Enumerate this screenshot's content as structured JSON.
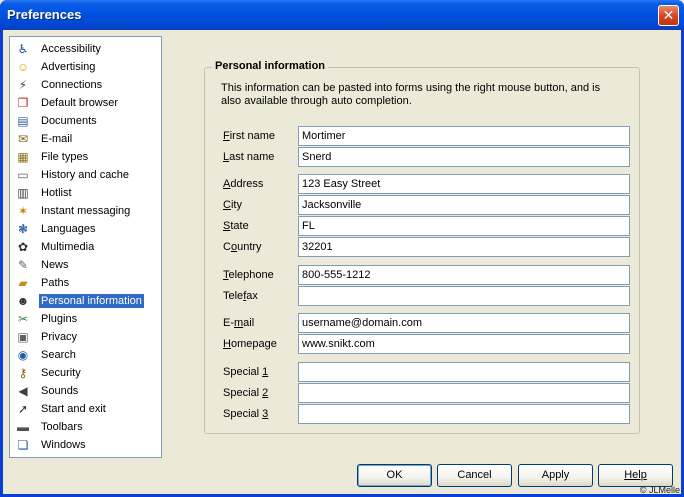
{
  "window": {
    "title": "Preferences",
    "close_glyph": "✕"
  },
  "categories": [
    {
      "label": "Accessibility",
      "icon": "accessibility-icon",
      "glyph": "♿",
      "color": "#1b3fa0"
    },
    {
      "label": "Advertising",
      "icon": "smiley-icon",
      "glyph": "☺",
      "color": "#d9a800"
    },
    {
      "label": "Connections",
      "icon": "connections-icon",
      "glyph": "⚡",
      "color": "#444444"
    },
    {
      "label": "Default browser",
      "icon": "browser-doc-icon",
      "glyph": "❐",
      "color": "#c02020"
    },
    {
      "label": "Documents",
      "icon": "documents-icon",
      "glyph": "▤",
      "color": "#3060a0"
    },
    {
      "label": "E-mail",
      "icon": "email-icon",
      "glyph": "✉",
      "color": "#806020"
    },
    {
      "label": "File types",
      "icon": "file-types-icon",
      "glyph": "▦",
      "color": "#907020"
    },
    {
      "label": "History and cache",
      "icon": "history-cache-icon",
      "glyph": "▭",
      "color": "#606060"
    },
    {
      "label": "Hotlist",
      "icon": "hotlist-icon",
      "glyph": "▥",
      "color": "#404040"
    },
    {
      "label": "Instant messaging",
      "icon": "instant-messaging-icon",
      "glyph": "✶",
      "color": "#c08000"
    },
    {
      "label": "Languages",
      "icon": "languages-icon",
      "glyph": "❃",
      "color": "#2050a0"
    },
    {
      "label": "Multimedia",
      "icon": "multimedia-icon",
      "glyph": "✿",
      "color": "#303030"
    },
    {
      "label": "News",
      "icon": "news-icon",
      "glyph": "✎",
      "color": "#606060"
    },
    {
      "label": "Paths",
      "icon": "paths-folder-icon",
      "glyph": "▰",
      "color": "#c09020"
    },
    {
      "label": "Personal information",
      "icon": "person-icon",
      "glyph": "☻",
      "color": "#303030"
    },
    {
      "label": "Plugins",
      "icon": "plugins-icon",
      "glyph": "✂",
      "color": "#408040"
    },
    {
      "label": "Privacy",
      "icon": "privacy-icon",
      "glyph": "▣",
      "color": "#606060"
    },
    {
      "label": "Search",
      "icon": "search-globe-icon",
      "glyph": "◉",
      "color": "#2060a0"
    },
    {
      "label": "Security",
      "icon": "security-keys-icon",
      "glyph": "⚷",
      "color": "#806000"
    },
    {
      "label": "Sounds",
      "icon": "sounds-speaker-icon",
      "glyph": "◀",
      "color": "#404040"
    },
    {
      "label": "Start and exit",
      "icon": "start-exit-icon",
      "glyph": "➚",
      "color": "#303030"
    },
    {
      "label": "Toolbars",
      "icon": "toolbars-icon",
      "glyph": "▬",
      "color": "#505050"
    },
    {
      "label": "Windows",
      "icon": "windows-icon",
      "glyph": "❏",
      "color": "#2050a0"
    }
  ],
  "selected_category": "Personal information",
  "panel": {
    "legend": "Personal information",
    "intro": "This information can be pasted into forms using the right mouse button, and is also available through auto completion.",
    "fields": [
      {
        "key": "first_name",
        "pre": "",
        "u": "F",
        "post": "irst name",
        "value": "Mortimer"
      },
      {
        "key": "last_name",
        "pre": "",
        "u": "L",
        "post": "ast name",
        "value": "Snerd"
      },
      {
        "key": "address",
        "pre": "",
        "u": "A",
        "post": "ddress",
        "value": "123 Easy Street"
      },
      {
        "key": "city",
        "pre": "",
        "u": "C",
        "post": "ity",
        "value": "Jacksonville"
      },
      {
        "key": "state",
        "pre": "",
        "u": "S",
        "post": "tate",
        "value": "FL"
      },
      {
        "key": "country",
        "pre": "C",
        "u": "o",
        "post": "untry",
        "value": "32201"
      },
      {
        "key": "telephone",
        "pre": "",
        "u": "T",
        "post": "elephone",
        "value": "800-555-1212"
      },
      {
        "key": "telefax",
        "pre": "Tele",
        "u": "f",
        "post": "ax",
        "value": ""
      },
      {
        "key": "email",
        "pre": "E-",
        "u": "m",
        "post": "ail",
        "value": "username@domain.com"
      },
      {
        "key": "homepage",
        "pre": "",
        "u": "H",
        "post": "omepage",
        "value": "www.snikt.com"
      },
      {
        "key": "special1",
        "pre": "Special ",
        "u": "1",
        "post": "",
        "value": ""
      },
      {
        "key": "special2",
        "pre": "Special ",
        "u": "2",
        "post": "",
        "value": ""
      },
      {
        "key": "special3",
        "pre": "Special ",
        "u": "3",
        "post": "",
        "value": ""
      }
    ]
  },
  "buttons": {
    "ok": "OK",
    "cancel": "Cancel",
    "apply": "Apply",
    "help": "Help"
  },
  "copyright": "© JLMelle"
}
